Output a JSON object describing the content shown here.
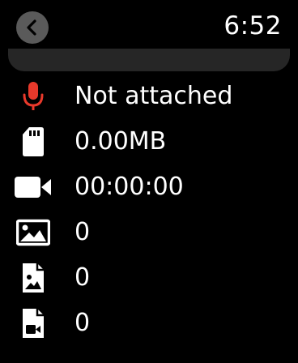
{
  "header": {
    "back_icon": "chevron-left-icon",
    "time": "6:52"
  },
  "colors": {
    "background": "#000000",
    "text": "#ffffff",
    "back_button": "#5a5a5a",
    "panel": "#262626",
    "microphone": "#e8392b"
  },
  "stats": {
    "microphone": {
      "icon": "microphone-icon",
      "value": "Not attached"
    },
    "storage": {
      "icon": "sd-card-icon",
      "value": "0.00MB"
    },
    "video_duration": {
      "icon": "video-camera-icon",
      "value": "00:00:00"
    },
    "images": {
      "icon": "image-icon",
      "value": "0"
    },
    "image_files": {
      "icon": "image-file-icon",
      "value": "0"
    },
    "video_files": {
      "icon": "video-file-icon",
      "value": "0"
    }
  }
}
